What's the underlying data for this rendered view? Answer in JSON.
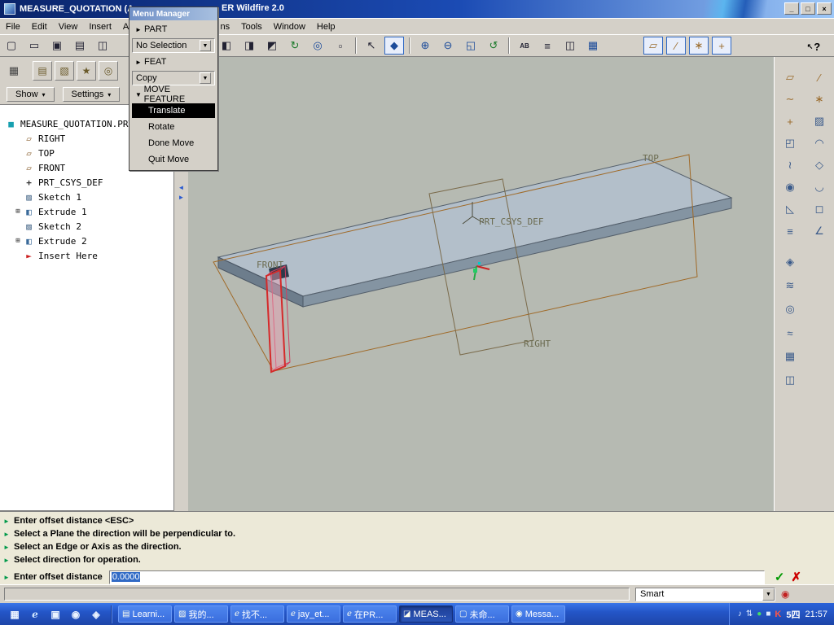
{
  "titlebar": {
    "title_left": "MEASURE_QUOTATION (A",
    "title_right": "ER Wildfire 2.0",
    "minimize": "_",
    "maximize": "□",
    "close": "×"
  },
  "menubar": {
    "items": [
      {
        "name": "menu-file",
        "label": "File"
      },
      {
        "name": "menu-edit",
        "label": "Edit"
      },
      {
        "name": "menu-view",
        "label": "View"
      },
      {
        "name": "menu-insert",
        "label": "Insert"
      },
      {
        "name": "menu-analysis",
        "label": "Ana"
      },
      {
        "name": "menu-applications",
        "label": "ns",
        "gap": true
      },
      {
        "name": "menu-tools",
        "label": "Tools"
      },
      {
        "name": "menu-window",
        "label": "Window"
      },
      {
        "name": "menu-help",
        "label": "Help"
      }
    ]
  },
  "toolbar_top": {
    "left_items": [
      {
        "name": "new-file-button",
        "glyph": "▢"
      },
      {
        "name": "open-file-button",
        "glyph": "▭"
      },
      {
        "name": "save-file-button",
        "glyph": "▣"
      },
      {
        "name": "print-button",
        "glyph": "▤"
      },
      {
        "name": "print-preview-button",
        "glyph": "◫"
      }
    ],
    "mid_items": [
      {
        "name": "copy-button",
        "glyph": "◧"
      },
      {
        "name": "paste-button",
        "glyph": "◨"
      },
      {
        "name": "paste-special-button",
        "glyph": "◩"
      },
      {
        "name": "regenerate-button",
        "glyph": "↻",
        "cls": "g"
      },
      {
        "name": "find-button",
        "glyph": "◎",
        "cls": "b"
      },
      {
        "name": "select-box-button",
        "glyph": "▫"
      },
      {
        "name": "toolbar-separator",
        "glyph": "",
        "cls": "sep"
      },
      {
        "name": "select-arrow-button",
        "glyph": "↖"
      },
      {
        "name": "smart-select-button",
        "glyph": "◆",
        "cls": "blue b"
      },
      {
        "name": "toolbar-separator",
        "glyph": "",
        "cls": "sep"
      },
      {
        "name": "zoom-in-button",
        "glyph": "⊕",
        "cls": "b"
      },
      {
        "name": "zoom-out-button",
        "glyph": "⊖",
        "cls": "b"
      },
      {
        "name": "refit-button",
        "glyph": "◱",
        "cls": "b"
      },
      {
        "name": "repaint-button",
        "glyph": "↺",
        "cls": "g"
      },
      {
        "name": "toolbar-separator",
        "glyph": "",
        "cls": "sep"
      },
      {
        "name": "annotation-button",
        "glyph": "AB",
        "cls": "txt"
      },
      {
        "name": "layers-button",
        "glyph": "≡"
      },
      {
        "name": "view-manager-button",
        "glyph": "◫"
      },
      {
        "name": "saved-views-button",
        "glyph": "▦",
        "cls": "b"
      }
    ],
    "toggle_items": [
      {
        "name": "datum-planes-toggle",
        "glyph": "▱",
        "cls": "blue o"
      },
      {
        "name": "datum-axes-toggle",
        "glyph": "∕",
        "cls": "blue o"
      },
      {
        "name": "datum-points-toggle",
        "glyph": "∗",
        "cls": "blue o"
      },
      {
        "name": "datum-csys-toggle",
        "glyph": "+",
        "cls": "blue o"
      }
    ],
    "help": {
      "arrow": "↖",
      "q": "?"
    }
  },
  "navigator": {
    "toggle_glyph": "▦",
    "tabs": [
      {
        "name": "model-tree-tab",
        "glyph": "▤"
      },
      {
        "name": "folder-browser-tab",
        "glyph": "▧"
      },
      {
        "name": "favorites-tab",
        "glyph": "★"
      },
      {
        "name": "history-tab",
        "glyph": "◎"
      }
    ],
    "show_label": "Show",
    "settings_label": "Settings",
    "arrow": "▾"
  },
  "model_tree": {
    "root": "MEASURE_QUOTATION.PRT",
    "root_icon": "■",
    "items": [
      {
        "name": "tree-item-right",
        "label": "RIGHT",
        "glyph": "▱",
        "icls": "ic-plane"
      },
      {
        "name": "tree-item-top",
        "label": "TOP",
        "glyph": "▱",
        "icls": "ic-plane"
      },
      {
        "name": "tree-item-front",
        "label": "FRONT",
        "glyph": "▱",
        "icls": "ic-plane"
      },
      {
        "name": "tree-item-csys",
        "label": "PRT_CSYS_DEF",
        "glyph": "+",
        "icls": "ic-csys"
      },
      {
        "name": "tree-item-sketch1",
        "label": "Sketch 1",
        "glyph": "▨",
        "icls": "ic-sketch"
      },
      {
        "name": "tree-item-extrude1",
        "label": "Extrude 1",
        "glyph": "◧",
        "icls": "ic-solid",
        "exp": "⊞"
      },
      {
        "name": "tree-item-sketch2",
        "label": "Sketch 2",
        "glyph": "▨",
        "icls": "ic-sketch"
      },
      {
        "name": "tree-item-extrude2",
        "label": "Extrude 2",
        "glyph": "◧",
        "icls": "ic-solid",
        "exp": "⊞"
      },
      {
        "name": "tree-item-insert-here",
        "label": "Insert Here",
        "glyph": "►",
        "icls": "ic-insert"
      }
    ]
  },
  "menu_manager": {
    "title": "Menu Manager",
    "rows": [
      {
        "name": "mm-part-header",
        "type": "header",
        "larr": "►",
        "label": "PART"
      },
      {
        "name": "mm-selection-combo",
        "type": "combo",
        "label": "No Selection",
        "rarr": "▼"
      },
      {
        "name": "mm-feat-header",
        "type": "header",
        "larr": "►",
        "label": "FEAT"
      },
      {
        "name": "mm-copy-combo",
        "type": "combo",
        "label": "Copy",
        "rarr": "▼"
      },
      {
        "name": "mm-move-feature-section",
        "type": "section",
        "larr": "▼",
        "label": "MOVE FEATURE"
      },
      {
        "name": "mm-translate-item",
        "type": "item",
        "label": "Translate",
        "selected": true
      },
      {
        "name": "mm-rotate-item",
        "type": "item",
        "label": "Rotate"
      },
      {
        "name": "mm-done-move-item",
        "type": "item",
        "label": "Done Move"
      },
      {
        "name": "mm-quit-move-item",
        "type": "item",
        "label": "Quit Move"
      }
    ]
  },
  "viewport": {
    "labels": {
      "top": "TOP",
      "front": "FRONT",
      "right": "RIGHT",
      "csys": "PRT_CSYS_DEF"
    }
  },
  "right_toolbar": {
    "grid_items": [
      {
        "name": "datum-plane-tool",
        "glyph": "▱",
        "cls": "o"
      },
      {
        "name": "datum-axis-tool",
        "glyph": "∕",
        "cls": "o"
      },
      {
        "name": "datum-curve-tool",
        "glyph": "∼",
        "cls": "o"
      },
      {
        "name": "datum-point-tool",
        "glyph": "∗",
        "cls": "o"
      },
      {
        "name": "datum-csys-tool",
        "glyph": "+",
        "cls": "o"
      },
      {
        "name": "sketch-tool",
        "glyph": "▨",
        "cls": "b"
      },
      {
        "name": "extrude-tool",
        "glyph": "◰",
        "cls": "b"
      },
      {
        "name": "revolve-tool",
        "glyph": "◠",
        "cls": "b"
      },
      {
        "name": "sweep-tool",
        "glyph": "≀",
        "cls": "b"
      },
      {
        "name": "blend-tool",
        "glyph": "◇",
        "cls": "b"
      },
      {
        "name": "hole-tool",
        "glyph": "◉",
        "cls": "b"
      },
      {
        "name": "round-tool",
        "glyph": "◡",
        "cls": "b"
      },
      {
        "name": "chamfer-tool",
        "glyph": "◺",
        "cls": "b"
      },
      {
        "name": "shell-tool",
        "glyph": "◻",
        "cls": "b"
      },
      {
        "name": "rib-tool",
        "glyph": "≡",
        "cls": "b"
      },
      {
        "name": "draft-tool",
        "glyph": "∠",
        "cls": "b"
      }
    ],
    "column_items": [
      {
        "name": "surface-tool",
        "glyph": "◈",
        "cls": "b"
      },
      {
        "name": "style-tool",
        "glyph": "≋",
        "cls": "b"
      },
      {
        "name": "wrap-tool",
        "glyph": "◎",
        "cls": "b"
      },
      {
        "name": "flex-tool",
        "glyph": "≈",
        "cls": "b"
      },
      {
        "name": "pattern-tool",
        "glyph": "▦",
        "cls": "b"
      },
      {
        "name": "mirror-tool",
        "glyph": "◫",
        "cls": "b"
      }
    ]
  },
  "message_area": {
    "messages": [
      {
        "icon": "►",
        "text": "Enter offset distance  <ESC>"
      },
      {
        "icon": "►",
        "text": "Select a Plane the direction will be perpendicular to."
      },
      {
        "icon": "►",
        "text": "Select an Edge or Axis as the direction."
      },
      {
        "icon": "►",
        "text": "Select direction for operation."
      }
    ],
    "prompt_icon": "►",
    "prompt_label": "Enter offset distance",
    "prompt_value": "0.0000",
    "accept": "✓",
    "cancel": "✗"
  },
  "status_bar": {
    "filter_label": "Smart",
    "arrow": "▼",
    "buffer_glyph": "◉"
  },
  "sash": {
    "left": "◄",
    "right": "►"
  },
  "taskbar": {
    "quick_launch": [
      {
        "name": "show-desktop-icon",
        "glyph": "▦"
      },
      {
        "name": "ie-quicklaunch-icon",
        "glyph": "e",
        "cls": "e"
      },
      {
        "name": "mail-quicklaunch-icon",
        "glyph": "▣"
      },
      {
        "name": "media-player-icon",
        "glyph": "◉"
      },
      {
        "name": "messenger-quicklaunch-icon",
        "glyph": "◈"
      }
    ],
    "tasks": [
      {
        "name": "task-learning",
        "icon": "▤",
        "label": "Learni..."
      },
      {
        "name": "task-my-documents",
        "icon": "▨",
        "label": "我的..."
      },
      {
        "name": "task-browser-1",
        "icon": "e",
        "icls": "e",
        "label": "找不..."
      },
      {
        "name": "task-browser-2",
        "icon": "e",
        "icls": "e",
        "label": "jay_et..."
      },
      {
        "name": "task-browser-3",
        "icon": "e",
        "icls": "e",
        "label": "在PR..."
      },
      {
        "name": "task-proe",
        "icon": "◪",
        "label": "MEAS...",
        "active": true
      },
      {
        "name": "task-untitled",
        "icon": "▢",
        "label": "未命..."
      },
      {
        "name": "task-messenger",
        "icon": "◉",
        "label": "Messa..."
      }
    ],
    "tray_icons": [
      {
        "name": "tray-volume-icon",
        "glyph": "♪"
      },
      {
        "name": "tray-network-icon",
        "glyph": "⇅"
      },
      {
        "name": "tray-antivirus-icon",
        "glyph": "●",
        "cls": "green"
      },
      {
        "name": "tray-update-icon",
        "glyph": "■"
      },
      {
        "name": "tray-k-icon",
        "glyph": "K",
        "cls": "red"
      }
    ],
    "ime": "5四",
    "clock": "21:57"
  }
}
